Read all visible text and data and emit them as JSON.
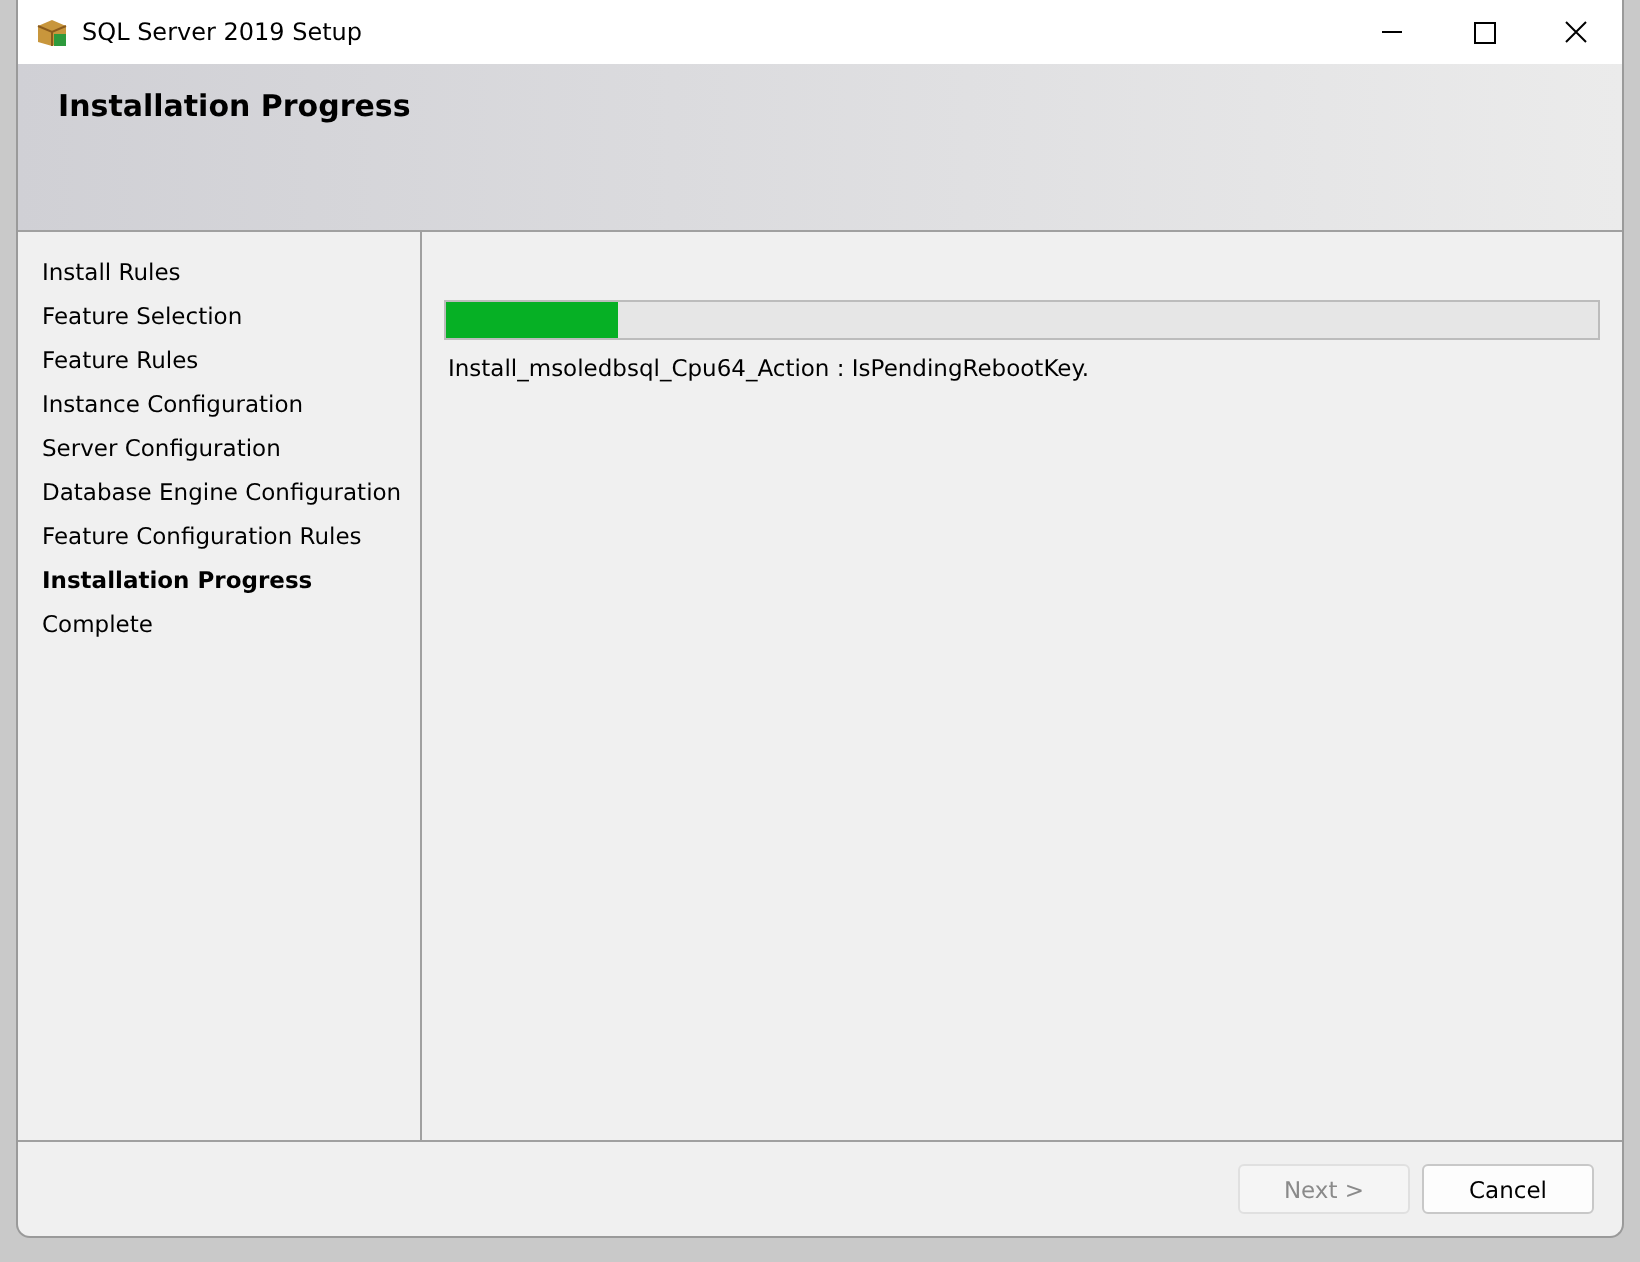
{
  "window": {
    "title": "SQL Server 2019 Setup"
  },
  "header": {
    "title": "Installation Progress"
  },
  "steps": [
    {
      "label": "Install Rules",
      "selected": false
    },
    {
      "label": "Feature Selection",
      "selected": false
    },
    {
      "label": "Feature Rules",
      "selected": false
    },
    {
      "label": "Instance Configuration",
      "selected": false
    },
    {
      "label": "Server Configuration",
      "selected": false
    },
    {
      "label": "Database Engine Configuration",
      "selected": false
    },
    {
      "label": "Feature Configuration Rules",
      "selected": false
    },
    {
      "label": "Installation Progress",
      "selected": true
    },
    {
      "label": "Complete",
      "selected": false
    }
  ],
  "progress": {
    "level": 0.15,
    "status": "Install_msoledbsql_Cpu64_Action : IsPendingRebootKey."
  },
  "buttons": [
    {
      "label": "Next >",
      "disabled": true
    },
    {
      "label": "Cancel",
      "disabled": false
    }
  ]
}
